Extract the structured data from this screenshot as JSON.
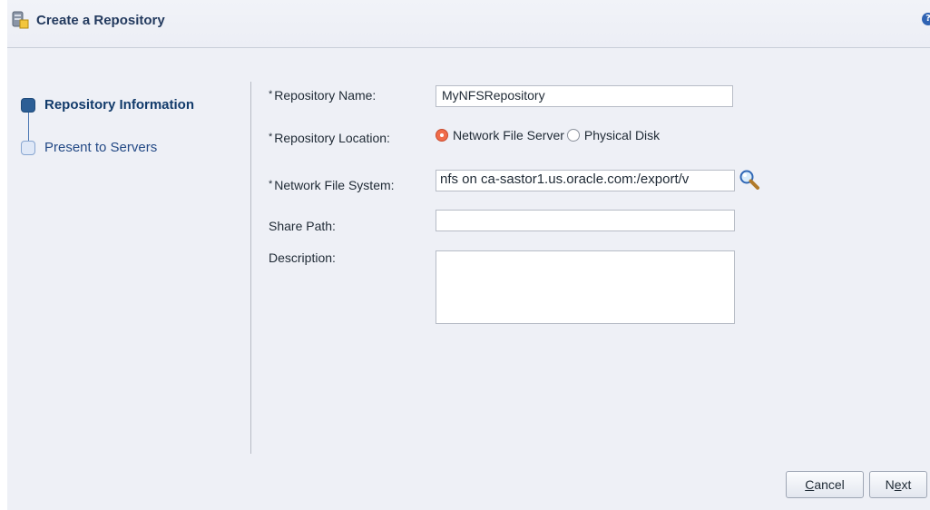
{
  "header": {
    "title": "Create a Repository",
    "icon": "repository-icon",
    "help_icon": "help-icon",
    "help_glyph": "?"
  },
  "train": {
    "steps": [
      {
        "label": "Repository Information",
        "state": "current"
      },
      {
        "label": "Present to Servers",
        "state": "next"
      }
    ]
  },
  "form": {
    "required_mark": "*",
    "repository_name": {
      "label": "Repository Name:",
      "value": "MyNFSRepository",
      "required": true
    },
    "repository_location": {
      "label": "Repository Location:",
      "required": true,
      "options": [
        {
          "label": "Network File Server",
          "selected": true
        },
        {
          "label": "Physical Disk",
          "selected": false
        }
      ]
    },
    "network_file_system": {
      "label": "Network File System:",
      "value": "nfs on ca-sastor1.us.oracle.com:/export/v",
      "required": true,
      "search_icon": "magnifier-icon"
    },
    "share_path": {
      "label": "Share Path:",
      "value": ""
    },
    "description": {
      "label": "Description:",
      "value": ""
    }
  },
  "buttons": {
    "cancel": {
      "mnemonic": "C",
      "rest": "ancel"
    },
    "next": {
      "pre": "N",
      "mnemonic": "e",
      "rest": "xt"
    }
  },
  "colors": {
    "background": "#eef0f6",
    "title": "#233a5e",
    "step_current": "#2c5e95",
    "radio_selected": "#f06c4a"
  }
}
